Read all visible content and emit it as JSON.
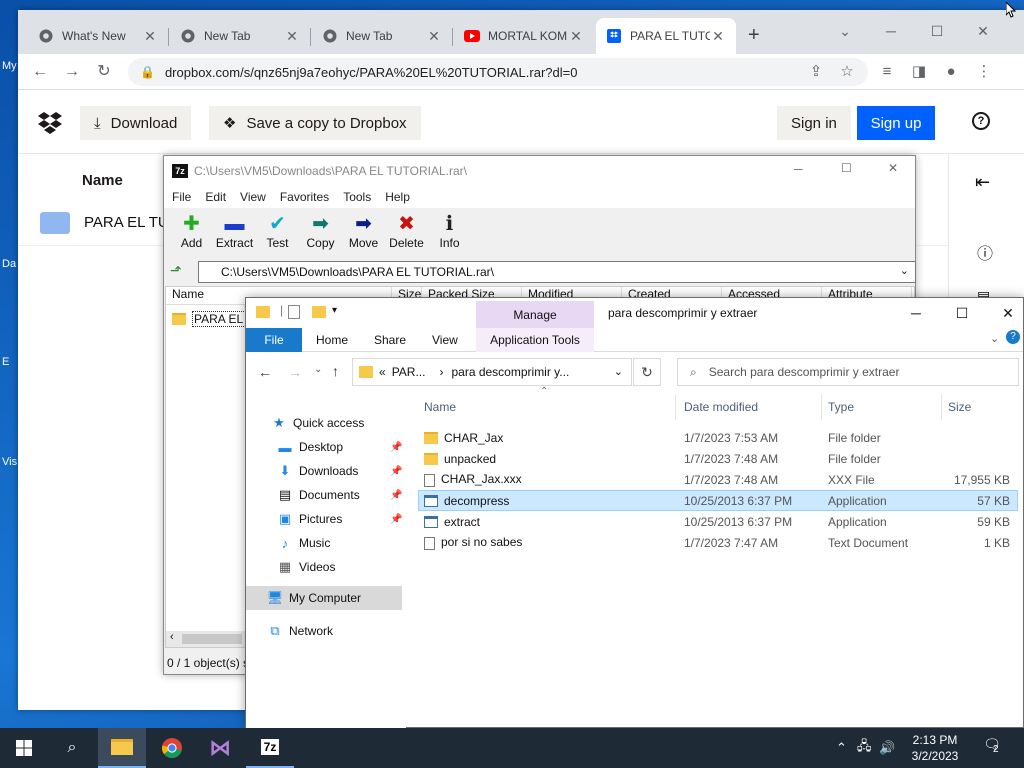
{
  "desktop": {
    "labels": [
      "My",
      "Da",
      "E",
      "Vis"
    ]
  },
  "browser": {
    "tabs": [
      {
        "title": "What's New",
        "icon": "chrome-icon"
      },
      {
        "title": "New Tab",
        "icon": "chrome-icon"
      },
      {
        "title": "New Tab",
        "icon": "chrome-icon"
      },
      {
        "title": "MORTAL KOMB",
        "icon": "youtube-icon"
      },
      {
        "title": "PARA EL TUTO",
        "icon": "dropbox-icon"
      }
    ],
    "url": "dropbox.com/s/qnz65nj9a7eohyc/PARA%20EL%20TUTORIAL.rar?dl=0"
  },
  "dropbox": {
    "download_label": "Download",
    "save_label": "Save a copy to Dropbox",
    "signin_label": "Sign in",
    "signup_label": "Sign up",
    "list_header": "Name",
    "row_name": "PARA EL TU",
    "help_glyph": "?",
    "accent": "#0061fe"
  },
  "sevenzip": {
    "title": "C:\\Users\\VM5\\Downloads\\PARA EL TUTORIAL.rar\\",
    "app_badge": "7z",
    "menu": [
      "File",
      "Edit",
      "View",
      "Favorites",
      "Tools",
      "Help"
    ],
    "tools": [
      {
        "label": "Add",
        "glyph": "✚",
        "color": "#22aa22"
      },
      {
        "label": "Extract",
        "glyph": "▬",
        "color": "#1a3cc8"
      },
      {
        "label": "Test",
        "glyph": "✔",
        "color": "#11aacc"
      },
      {
        "label": "Copy",
        "glyph": "➡",
        "color": "#117766"
      },
      {
        "label": "Move",
        "glyph": "➡",
        "color": "#0a2088"
      },
      {
        "label": "Delete",
        "glyph": "✖",
        "color": "#cc1111"
      },
      {
        "label": "Info",
        "glyph": "ℹ",
        "color": "#222222"
      }
    ],
    "address": "C:\\Users\\VM5\\Downloads\\PARA EL TUTORIAL.rar\\",
    "columns": [
      "Name",
      "Size",
      "Packed Size",
      "Modified",
      "Created",
      "Accessed",
      "Attribute"
    ],
    "item": "PARA EL TU",
    "status": "0 / 1 object(s) s"
  },
  "explorer": {
    "manage_label": "Manage",
    "title": "para descomprimir y extraer",
    "ribbon": {
      "file": "File",
      "home": "Home",
      "share": "Share",
      "view": "View",
      "app_tools": "Application Tools"
    },
    "address": {
      "prefix": "«",
      "parent": "PAR...",
      "sep": "›",
      "current": "para descomprimir y..."
    },
    "search_placeholder": "Search para descomprimir y extraer",
    "nav": {
      "quick_access": "Quick access",
      "desktop": "Desktop",
      "downloads": "Downloads",
      "documents": "Documents",
      "pictures": "Pictures",
      "music": "Music",
      "videos": "Videos",
      "my_computer": "My Computer",
      "network": "Network"
    },
    "columns": {
      "name": "Name",
      "date": "Date modified",
      "type": "Type",
      "size": "Size"
    },
    "files": [
      {
        "name": "CHAR_Jax",
        "date": "1/7/2023 7:53 AM",
        "type": "File folder",
        "size": "",
        "kind": "folder"
      },
      {
        "name": "unpacked",
        "date": "1/7/2023 7:48 AM",
        "type": "File folder",
        "size": "",
        "kind": "folder"
      },
      {
        "name": "CHAR_Jax.xxx",
        "date": "1/7/2023 7:48 AM",
        "type": "XXX File",
        "size": "17,955 KB",
        "kind": "file"
      },
      {
        "name": "decompress",
        "date": "10/25/2013 6:37 PM",
        "type": "Application",
        "size": "57 KB",
        "kind": "app"
      },
      {
        "name": "extract",
        "date": "10/25/2013 6:37 PM",
        "type": "Application",
        "size": "59 KB",
        "kind": "app"
      },
      {
        "name": "por si no sabes",
        "date": "1/7/2023 7:47 AM",
        "type": "Text Document",
        "size": "1 KB",
        "kind": "file"
      }
    ]
  },
  "taskbar": {
    "time": "2:13 PM",
    "date": "3/2/2023",
    "notifications": "2"
  }
}
